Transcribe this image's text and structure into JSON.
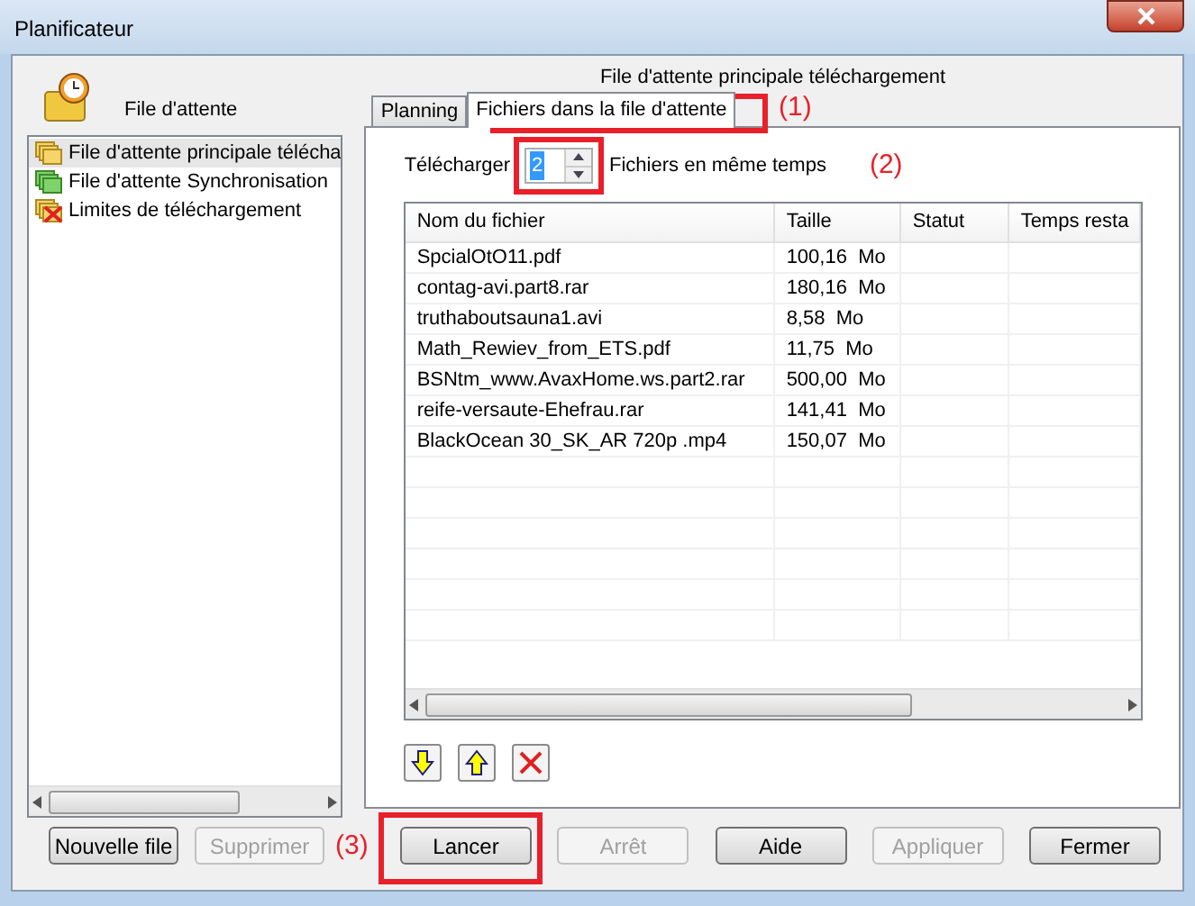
{
  "window": {
    "title": "Planificateur"
  },
  "left_panel": {
    "title": "File d'attente",
    "items": [
      {
        "label": "File d'attente principale télécha",
        "kind": "main",
        "selected": true
      },
      {
        "label": "File d'attente Synchronisation",
        "kind": "sync",
        "selected": false
      },
      {
        "label": "Limites de téléchargement",
        "kind": "limits",
        "selected": false
      }
    ],
    "buttons": [
      {
        "label": "Nouvelle file",
        "disabled": false
      },
      {
        "label": "Supprimer",
        "disabled": true
      }
    ]
  },
  "right_panel": {
    "title": "File d'attente principale téléchargement",
    "tabs": [
      {
        "label": "Planning",
        "selected": false
      },
      {
        "label": "Fichiers dans la file d'attente",
        "selected": true
      }
    ],
    "download_label": "Télécharger",
    "spinner_value": "2",
    "files_label": "Fichiers en même temps",
    "table": {
      "columns": [
        "Nom du fichier",
        "Taille",
        "Statut",
        "Temps resta"
      ],
      "rows": [
        [
          "SpcialOtO11.pdf",
          "100,16  Mo"
        ],
        [
          "contag-avi.part8.rar",
          "180,16  Mo"
        ],
        [
          "truthaboutsauna1.avi",
          "8,58  Mo"
        ],
        [
          "Math_Rewiev_from_ETS.pdf",
          "11,75  Mo"
        ],
        [
          "BSNtm_www.AvaxHome.ws.part2.rar",
          "500,00  Mo"
        ],
        [
          "reife-versaute-Ehefrau.rar",
          "141,41  Mo"
        ],
        [
          "BlackOcean 30_SK_AR 720p .mp4",
          "150,07  Mo"
        ]
      ]
    },
    "tools": [
      {
        "kind": "down"
      },
      {
        "kind": "up"
      },
      {
        "kind": "delete"
      }
    ]
  },
  "buttons": [
    {
      "label": "Lancer",
      "disabled": false
    },
    {
      "label": "Arrêt",
      "disabled": true
    },
    {
      "label": "Aide",
      "disabled": false
    },
    {
      "label": "Appliquer",
      "disabled": true
    },
    {
      "label": "Fermer",
      "disabled": false
    }
  ],
  "annotations": [
    "(1)",
    "(2)",
    "(3)"
  ]
}
